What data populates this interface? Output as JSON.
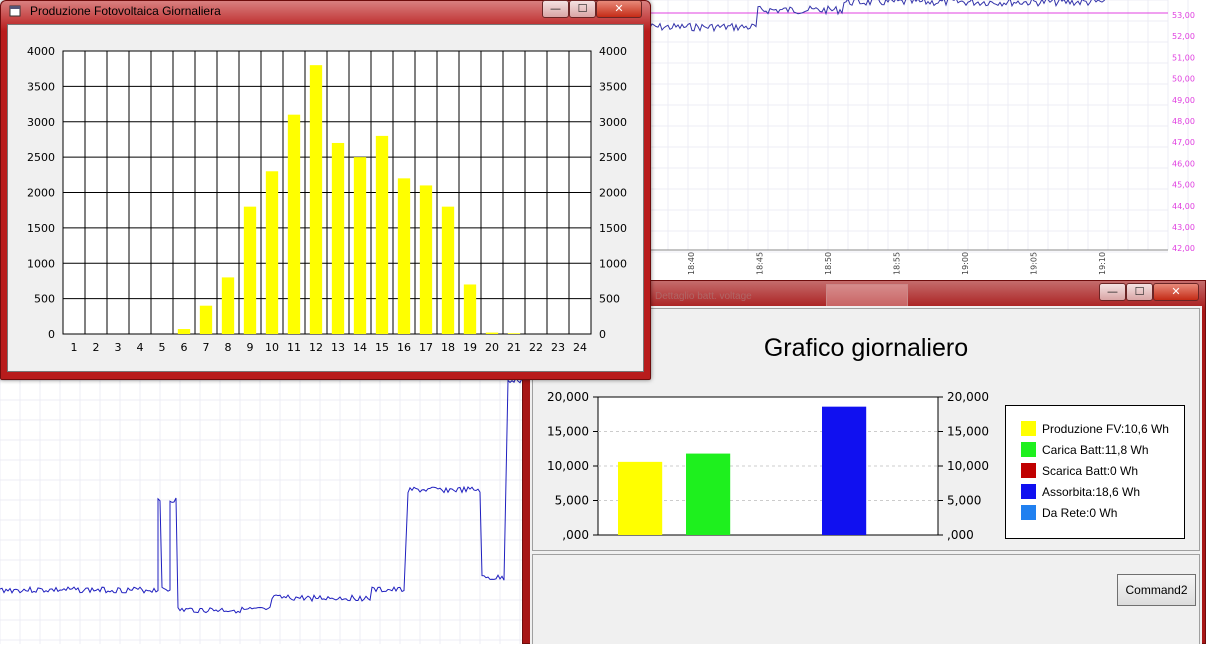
{
  "background_top": {
    "x_ticks": [
      "18:40",
      "18:45",
      "18:50",
      "18:55",
      "19:00",
      "19:05",
      "19:10"
    ],
    "y_ticks": [
      "53,00",
      "52,00",
      "51,00",
      "50,00",
      "49,00",
      "48,00",
      "47,00",
      "46,00",
      "45,00",
      "44,00",
      "43,00",
      "42,00"
    ],
    "line_color": "#3333aa",
    "ref_color": "#e040e0"
  },
  "background_bottom": {
    "line_color": "#1f1fbf"
  },
  "window1": {
    "title": "Produzione Fotovoltaica Giornaliera",
    "minimize": "—",
    "maximize": "☐",
    "close": "✕",
    "chart_data": {
      "type": "bar",
      "categories": [
        "1",
        "2",
        "3",
        "4",
        "5",
        "6",
        "7",
        "8",
        "9",
        "10",
        "11",
        "12",
        "13",
        "14",
        "15",
        "16",
        "17",
        "18",
        "19",
        "20",
        "21",
        "22",
        "23",
        "24"
      ],
      "values": [
        0,
        0,
        0,
        0,
        0,
        70,
        400,
        800,
        1800,
        2300,
        3100,
        3800,
        2700,
        2500,
        2800,
        2200,
        2100,
        1800,
        700,
        20,
        10,
        0,
        0,
        0
      ],
      "y_ticks": [
        "0",
        "500",
        "1000",
        "1500",
        "2000",
        "2500",
        "3000",
        "3500",
        "4000"
      ],
      "ylim": [
        0,
        4000
      ],
      "grid": true,
      "bar_color": "#ffff00"
    }
  },
  "window2": {
    "ghost_title": "Dettaglio batt. voltage",
    "minimize": "—",
    "maximize": "☐",
    "close": "✕",
    "command_label": "Command2",
    "chart_data": {
      "type": "bar",
      "title": "Grafico giornaliero",
      "categories": [
        "Produzione FV",
        "Carica Batt",
        "Scarica Batt",
        "Assorbita",
        "Da Rete"
      ],
      "values": [
        10600,
        11800,
        0,
        18600,
        0
      ],
      "colors": [
        "#ffff00",
        "#1ef01e",
        "#c00000",
        "#1010f0",
        "#2080f0"
      ],
      "y_ticks": [
        ",000",
        "5,000",
        "10,000",
        "15,000",
        "20,000"
      ],
      "ylim": [
        0,
        20000
      ],
      "legend_position": "right",
      "legend": [
        {
          "label": "Produzione FV:10,6 Wh",
          "color": "#ffff00"
        },
        {
          "label": "Carica Batt:11,8 Wh",
          "color": "#1ef01e"
        },
        {
          "label": "Scarica Batt:0 Wh",
          "color": "#c00000"
        },
        {
          "label": "Assorbita:18,6 Wh",
          "color": "#1010f0"
        },
        {
          "label": "Da Rete:0 Wh",
          "color": "#2080f0"
        }
      ]
    }
  }
}
